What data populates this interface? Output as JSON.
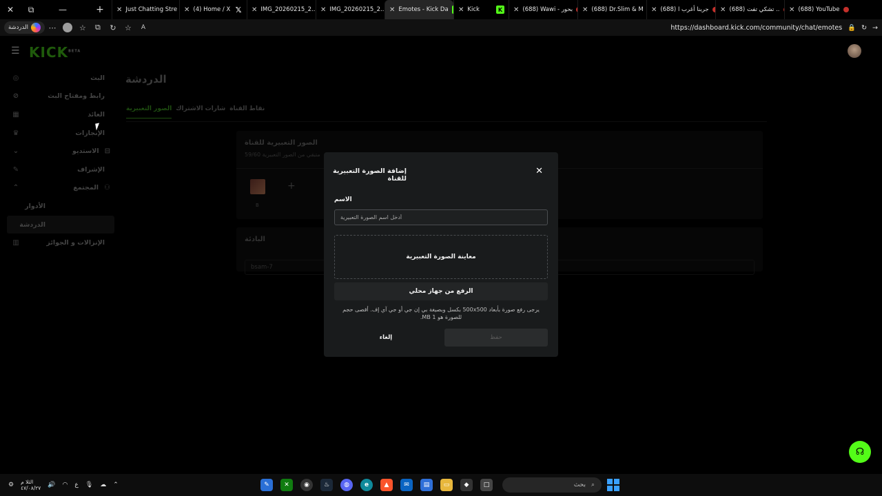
{
  "browser": {
    "tabs": [
      {
        "title": "Just Chatting Stre",
        "favicon": "kick-icon"
      },
      {
        "title": "(4) Home / X",
        "favicon": "x-icon"
      },
      {
        "title": "IMG_20260215_2...",
        "favicon": "globe-icon"
      },
      {
        "title": "IMG_20260215_2...",
        "favicon": "globe-icon"
      },
      {
        "title": "Emotes - Kick Da",
        "favicon": "kick-icon",
        "active": true
      },
      {
        "title": "Kick",
        "favicon": "kick-icon"
      },
      {
        "title": "(688) Wawi - بحور",
        "favicon": "youtube-icon"
      },
      {
        "title": "(688) Dr.Slim & M",
        "favicon": "youtube-icon"
      },
      {
        "title": "(688) جربنا أغرب ا",
        "favicon": "youtube-icon"
      },
      {
        "title": "(688) تشكي تفت ..",
        "favicon": "youtube-icon"
      },
      {
        "title": "(688) YouTube",
        "favicon": "youtube-icon"
      }
    ],
    "profile_chip": "الدردشة",
    "url": "https://dashboard.kick.com/community/chat/emotes"
  },
  "brand": {
    "logo": "KICK",
    "logo_tag": "BETA",
    "accent": "#53fc18"
  },
  "sidebar": {
    "items": [
      {
        "label": "البث",
        "icon": "broadcast-icon"
      },
      {
        "label": "رابط ومفتاح البث",
        "icon": "link-icon"
      },
      {
        "label": "العائد",
        "icon": "revenue-icon"
      },
      {
        "label": "الإنجازات",
        "icon": "trophy-icon"
      },
      {
        "label": "الاستديو",
        "icon": "chevron-down-icon"
      },
      {
        "label": "الإشراف",
        "icon": "wrench-icon"
      },
      {
        "label": "المجتمع",
        "icon": "chevron-up-icon"
      },
      {
        "label": "الأدوار",
        "icon": ""
      },
      {
        "label": "الدردشة",
        "icon": ""
      },
      {
        "label": "الإنزالات و الجوائز",
        "icon": "gift-icon"
      }
    ]
  },
  "main": {
    "heading": "الدردشة",
    "tabs": [
      "الصور التعبيرية",
      "شارات الاشتراك",
      "نقاط القناة"
    ],
    "emote_card": {
      "title": "الصور التعبيرية للقناة",
      "subtitle": "59/60 متبقي من الصور التعبيرية",
      "thumb_label": "B",
      "add_symbol": "+"
    },
    "prefix_card": {
      "title": "البادئة",
      "value": "bsam-7"
    }
  },
  "modal": {
    "title": "إضافة الصورة التعبيرية للقناة",
    "close_symbol": "✕",
    "name_label": "الاسم",
    "name_placeholder": "أدخل اسم الصورة التعبيرية",
    "preview_label": "معاينة الصورة التعبيرية",
    "upload_label": "الرفع من جهاز محلي",
    "help_text": "يرجى رفع صورة بأبعاد 500x500 بكسل وبصيغة بي إن جي أو جي آي إف. أقصى حجم للصورة هو 1 MB.",
    "cancel_label": "إلغاء",
    "save_label": "حفظ"
  },
  "taskbar": {
    "clock_time": "الثلا م",
    "clock_date": "٤٧/٠٨/٢٧",
    "lang": "ع",
    "search_placeholder": "بحث"
  }
}
